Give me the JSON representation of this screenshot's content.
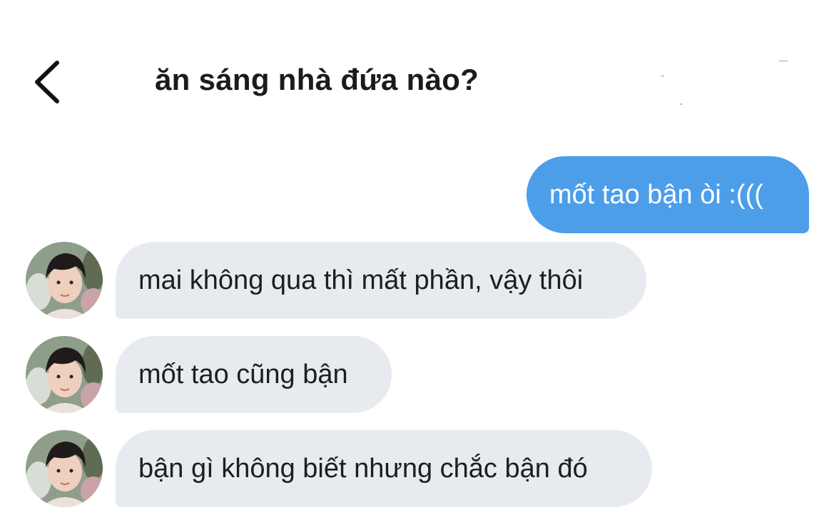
{
  "header": {
    "back_icon": "chevron-left-icon",
    "title": "ăn sáng nhà đứa nào?"
  },
  "messages": [
    {
      "direction": "outgoing",
      "text": "mốt tao bận òi :((("
    },
    {
      "direction": "incoming",
      "text": "mai không qua thì mất phần, vậy thôi",
      "avatar_icon": "profile-photo"
    },
    {
      "direction": "incoming",
      "text": "mốt tao cũng bận",
      "avatar_icon": "profile-photo"
    },
    {
      "direction": "incoming",
      "text": "bận gì không biết nhưng chắc bận đó",
      "avatar_icon": "profile-photo"
    }
  ],
  "colors": {
    "outgoing_bubble": "#4c9ee9",
    "incoming_bubble": "#e7ebef",
    "title_text": "#1b1b1b"
  }
}
